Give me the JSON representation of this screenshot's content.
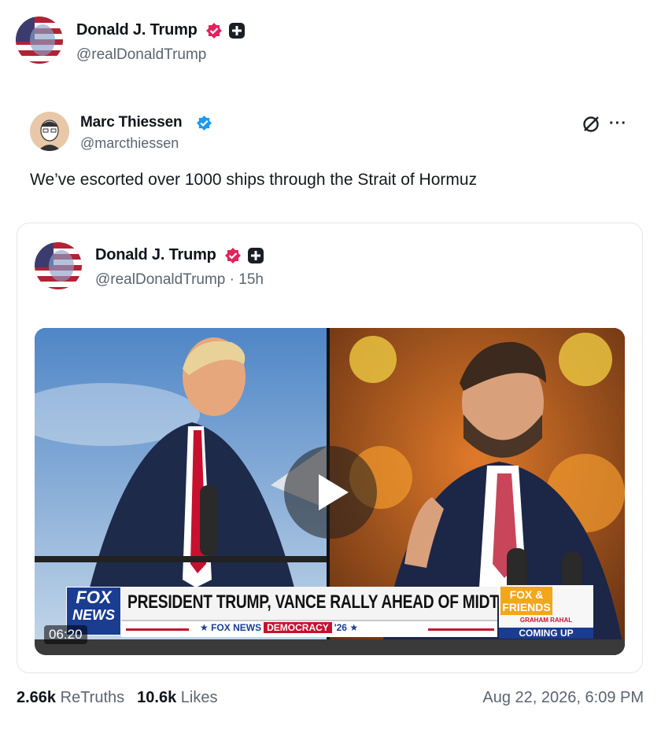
{
  "top_author": {
    "name": "Donald J. Trump",
    "handle": "@realDonaldTrump"
  },
  "quoted_author": {
    "name": "Marc Thiessen",
    "handle": "@marcthiessen"
  },
  "post_text": "We’ve escorted over 1000 ships through the Strait of Hormuz",
  "card": {
    "author_name": "Donald J. Trump",
    "author_handle_time": "@realDonaldTrump · 15h",
    "video": {
      "duration": "06:20",
      "chyron_headline": "PRESIDENT TRUMP, VANCE RALLY AHEAD OF MIDTERMS",
      "network_logo_line1": "FOX",
      "network_logo_line2": "NEWS",
      "sub_network": "FOX NEWS",
      "sub_tag": "DEMOCRACY",
      "sub_year": "'26",
      "show_logo": "FOX & FRIENDS",
      "guest": "GRAHAM RAHAL",
      "coming_up": "COMING UP"
    }
  },
  "stats": {
    "retruths_count": "2.66k",
    "retruths_label": "ReTruths",
    "likes_count": "10.6k",
    "likes_label": "Likes",
    "timestamp": "Aug 22, 2026, 6:09 PM"
  },
  "colors": {
    "verified_trump": "#e0245e",
    "verified_marc": "#1d9bf0",
    "muted_text": "#5b6470",
    "fox_blue": "#1a3d92",
    "fox_red": "#c8102e"
  },
  "icons": [
    "flag-avatar",
    "verified-badge-icon",
    "plus-badge-icon",
    "no-sign-icon",
    "more-icon",
    "play-icon"
  ]
}
